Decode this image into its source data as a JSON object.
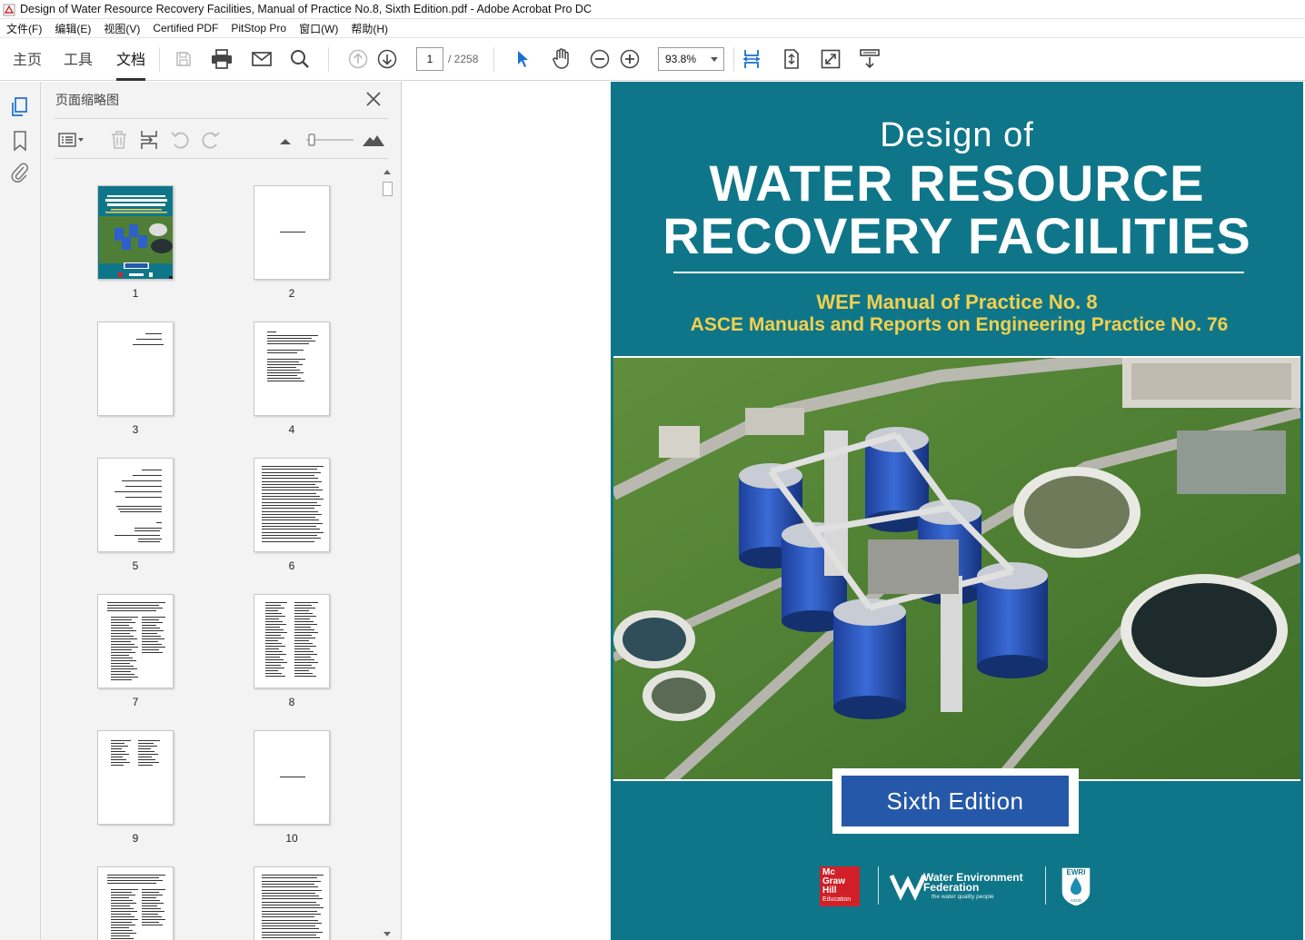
{
  "window": {
    "title": "Design of Water Resource Recovery Facilities, Manual of Practice No.8, Sixth Edition.pdf - Adobe Acrobat Pro DC"
  },
  "menubar": {
    "items": [
      "文件(F)",
      "编辑(E)",
      "视图(V)",
      "Certified PDF",
      "PitStop Pro",
      "窗口(W)",
      "帮助(H)"
    ]
  },
  "toolbar": {
    "tabs": [
      "主页",
      "工具",
      "文档"
    ],
    "active_tab": "文档",
    "page_current": "1",
    "page_total": "/ 2258",
    "zoom": "93.8%",
    "icons": [
      "save-icon",
      "print-icon",
      "email-icon",
      "search-icon",
      "prev-page-icon",
      "next-page-icon",
      "select-cursor-icon",
      "hand-icon",
      "zoom-out-icon",
      "zoom-in-icon",
      "fit-page-icon",
      "fit-width-icon",
      "fullscreen-icon",
      "page-display-icon"
    ]
  },
  "left_rail": {
    "icons": [
      "page-thumbnails-icon",
      "bookmark-icon",
      "attachment-icon"
    ]
  },
  "thumbnail_panel": {
    "title": "页面缩略图",
    "tools": [
      "options-menu-icon",
      "delete-icon",
      "insert-page-icon",
      "rotate-left-icon",
      "rotate-right-icon",
      "zoom-small-icon",
      "zoom-slider",
      "zoom-large-icon"
    ],
    "thumbnails": [
      {
        "page": "1",
        "kind": "cover"
      },
      {
        "page": "2",
        "kind": "blank-text"
      },
      {
        "page": "3",
        "kind": "half-title"
      },
      {
        "page": "4",
        "kind": "text-page"
      },
      {
        "page": "5",
        "kind": "title-page"
      },
      {
        "page": "6",
        "kind": "dense-text"
      },
      {
        "page": "7",
        "kind": "list-text"
      },
      {
        "page": "8",
        "kind": "two-column"
      },
      {
        "page": "9",
        "kind": "short-list"
      },
      {
        "page": "10",
        "kind": "blank-text"
      },
      {
        "page": "",
        "kind": "list-text"
      },
      {
        "page": "",
        "kind": "dense-text"
      }
    ]
  },
  "cover": {
    "title_line1": "Design of",
    "title_line2": "WATER RESOURCE",
    "title_line3": "RECOVERY FACILITIES",
    "subtitle_line1": "WEF Manual of Practice No. 8",
    "subtitle_line2": "ASCE Manuals and Reports on Engineering Practice No. 76",
    "edition": "Sixth Edition",
    "publisher_logo": {
      "line1": "Mc",
      "line2": "Graw",
      "line3": "Hill",
      "line4": "Education"
    },
    "wef_logo": {
      "line1": "Water Environment",
      "line2": "Federation",
      "tagline": "the water quality people"
    },
    "ewri_logo": {
      "text": "EWRI",
      "subtext": "ASCE"
    },
    "colors": {
      "background": "#0f7689",
      "subtitle": "#f3d04e",
      "edition_box": "#2558a8"
    }
  }
}
